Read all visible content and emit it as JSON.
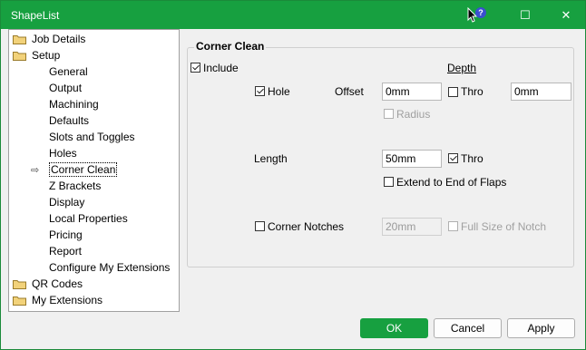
{
  "window": {
    "title": "ShapeList"
  },
  "titlebar": {
    "minimize": "—",
    "maximize": "☐",
    "close": "✕",
    "help": "?"
  },
  "tree": {
    "items": [
      {
        "label": "Job Details",
        "folder": true
      },
      {
        "label": "Setup",
        "folder": true
      },
      {
        "label": "General"
      },
      {
        "label": "Output"
      },
      {
        "label": "Machining"
      },
      {
        "label": "Defaults"
      },
      {
        "label": "Slots and Toggles"
      },
      {
        "label": "Holes"
      },
      {
        "label": "Corner Clean",
        "selected": true
      },
      {
        "label": "Z Brackets"
      },
      {
        "label": "Display"
      },
      {
        "label": "Local Properties"
      },
      {
        "label": "Pricing"
      },
      {
        "label": "Report"
      },
      {
        "label": "Configure My Extensions"
      },
      {
        "label": "QR Codes",
        "folder": true
      },
      {
        "label": "My Extensions",
        "folder": true
      }
    ]
  },
  "panel": {
    "title": "Corner Clean",
    "include": "Include",
    "depth": "Depth",
    "hole": "Hole",
    "offset": "Offset",
    "offset_value": "0mm",
    "thro": "Thro",
    "depth_value": "0mm",
    "radius": "Radius",
    "length": "Length",
    "length_value": "50mm",
    "thro2": "Thro",
    "extend": "Extend to End of Flaps",
    "corner_notches": "Corner Notches",
    "notch_value": "20mm",
    "full_size": "Full Size of Notch"
  },
  "footer": {
    "ok": "OK",
    "cancel": "Cancel",
    "apply": "Apply"
  },
  "colors": {
    "accent": "#17a040"
  }
}
